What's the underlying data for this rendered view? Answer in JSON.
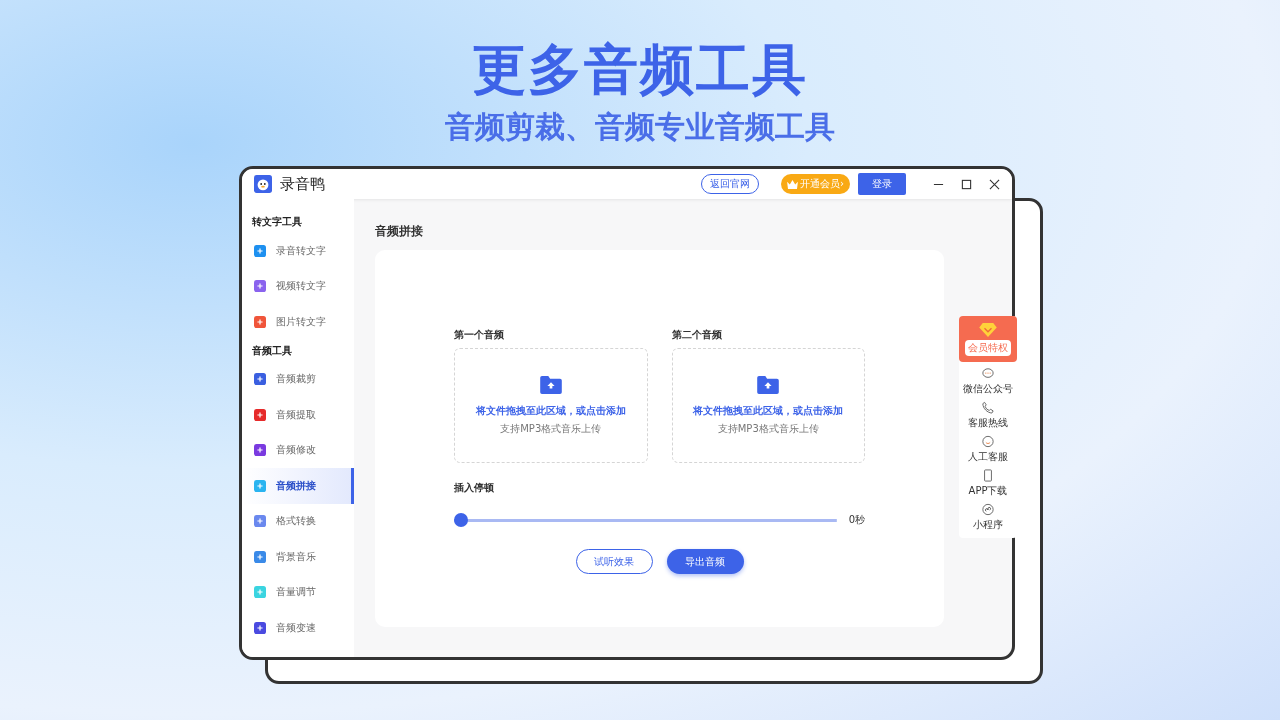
{
  "headline": {
    "title": "更多音频工具",
    "subtitle": "音频剪裁、音频专业音频工具"
  },
  "window": {
    "app_name": "录音鸭",
    "website_button": "返回官网",
    "vip_button": "开通会员›",
    "login_button": "登录"
  },
  "sidebar": {
    "sections": [
      {
        "title": "转文字工具",
        "items": [
          {
            "label": "录音转文字",
            "color": "#1e90f0",
            "selected": false
          },
          {
            "label": "视频转文字",
            "color": "#8a63ee",
            "selected": false
          },
          {
            "label": "图片转文字",
            "color": "#f0553a",
            "selected": false
          }
        ]
      },
      {
        "title": "音频工具",
        "items": [
          {
            "label": "音频裁剪",
            "color": "#3a5fe0",
            "selected": false
          },
          {
            "label": "音频提取",
            "color": "#e62a2a",
            "selected": false
          },
          {
            "label": "音频修改",
            "color": "#7a3ae0",
            "selected": false
          },
          {
            "label": "音频拼接",
            "color": "#2ab4f0",
            "selected": true
          },
          {
            "label": "格式转换",
            "color": "#6a88ee",
            "selected": false
          },
          {
            "label": "背景音乐",
            "color": "#3a8ae8",
            "selected": false
          },
          {
            "label": "音量调节",
            "color": "#3ad4e0",
            "selected": false
          },
          {
            "label": "音频变速",
            "color": "#4a4ae0",
            "selected": false
          }
        ]
      }
    ]
  },
  "main": {
    "title": "音频拼接",
    "uploads": [
      {
        "label": "第一个音频",
        "prompt": "将文件拖拽至此区域，或点击添加",
        "hint": "支持MP3格式音乐上传"
      },
      {
        "label": "第二个音频",
        "prompt": "将文件拖拽至此区域，或点击添加",
        "hint": "支持MP3格式音乐上传"
      }
    ],
    "pause": {
      "label": "插入停顿",
      "level": 0,
      "reading": "0秒"
    },
    "buttons": [
      {
        "label": "试听效果",
        "kind": "outline"
      },
      {
        "label": "导出音频",
        "kind": "primary"
      }
    ]
  },
  "side_panel": {
    "vip": "会员特权",
    "items": [
      {
        "label": "微信公众号",
        "kind": "chat"
      },
      {
        "label": "客服热线",
        "kind": "phone"
      },
      {
        "label": "人工客服",
        "kind": "smile"
      },
      {
        "label": "APP下载",
        "kind": "mobile"
      },
      {
        "label": "小程序",
        "kind": "mini"
      }
    ]
  }
}
